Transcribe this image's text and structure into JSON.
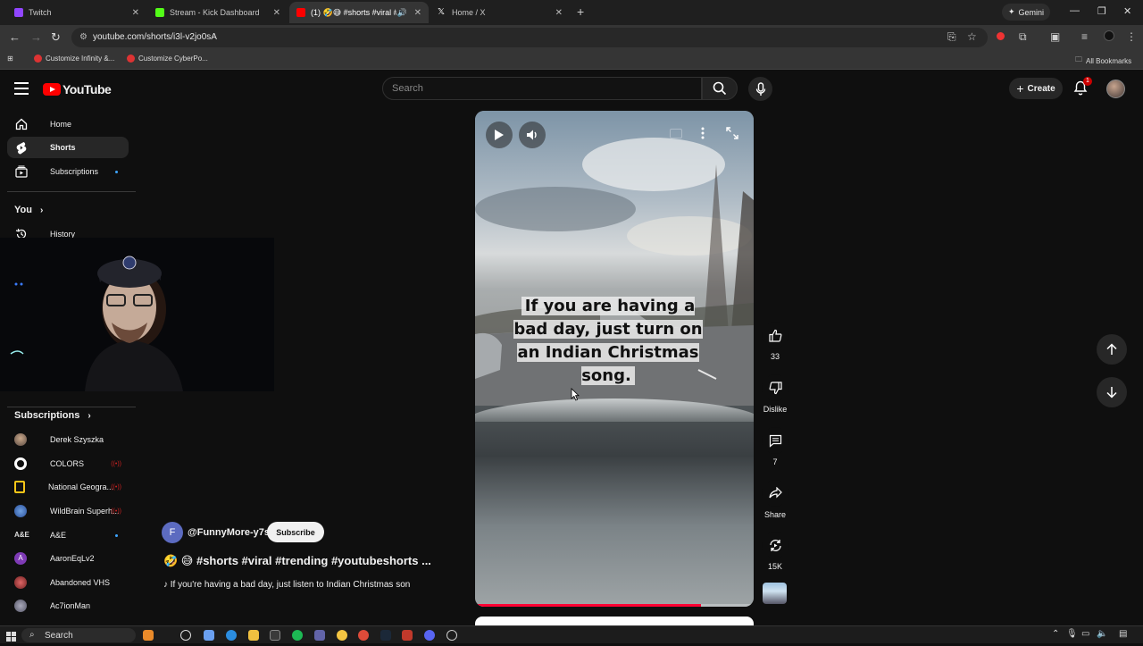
{
  "browser": {
    "tabs": [
      {
        "title": "Twitch",
        "favicon_color": "#9146ff"
      },
      {
        "title": "Stream - Kick Dashboard",
        "favicon_color": "#53fc18"
      },
      {
        "title": "(1) 🤣😅 #shorts #viral #tr",
        "favicon_color": "#ff0000",
        "active": true
      },
      {
        "title": "Home / X",
        "favicon_color": "#ffffff"
      }
    ],
    "new_tab": "+",
    "gemini_label": "Gemini",
    "window_controls": {
      "minimize": "—",
      "restore": "❐",
      "close": "✕"
    },
    "url": "youtube.com/shorts/i3l-v2jo0sA",
    "bookmarks": [
      {
        "label": "Customize Infinity &..."
      },
      {
        "label": "Customize CyberPo..."
      }
    ],
    "all_bookmarks": "All Bookmarks"
  },
  "youtube": {
    "logo_text": "YouTube",
    "search_placeholder": "Search",
    "create_label": "Create",
    "notification_count": "1"
  },
  "sidebar": {
    "main": [
      {
        "label": "Home",
        "icon": "home-icon"
      },
      {
        "label": "Shorts",
        "icon": "shorts-icon",
        "active": true
      },
      {
        "label": "Subscriptions",
        "icon": "subscriptions-icon"
      }
    ],
    "you_label": "You",
    "you_items": [
      {
        "label": "History",
        "icon": "history-icon"
      }
    ],
    "subscriptions_label": "Subscriptions",
    "subscriptions": [
      {
        "label": "Derek Szyszka",
        "color": "#8d7b6b"
      },
      {
        "label": "COLORS",
        "color": "#ffffff",
        "live": true
      },
      {
        "label": "National Geogra...",
        "color": "#f5c518",
        "live": true
      },
      {
        "label": "WildBrain Superh...",
        "color": "#3c6fc0",
        "live": true
      },
      {
        "label": "A&E",
        "color": "#cccccc",
        "new": true
      },
      {
        "label": "AaronEqLv2",
        "color": "#7e3ab5"
      },
      {
        "label": "Abandoned VHS",
        "color": "#b03030"
      },
      {
        "label": "Ac7ionMan",
        "color": "#889"
      }
    ]
  },
  "short": {
    "caption": "If you are having a bad day, just turn on an Indian Christmas song.",
    "progress": 0.81,
    "channel_initial": "F",
    "channel": "@FunnyMore-y7s",
    "subscribe_label": "Subscribe",
    "title": "🤣 😅 #shorts #viral #trending #youtubeshorts ...",
    "sound": "♪ If you're having a bad day, just listen to Indian Christmas son",
    "likes": "33",
    "dislike_label": "Dislike",
    "comments": "7",
    "share_label": "Share",
    "remix_count": "15K"
  },
  "taskbar": {
    "search_label": "Search"
  }
}
